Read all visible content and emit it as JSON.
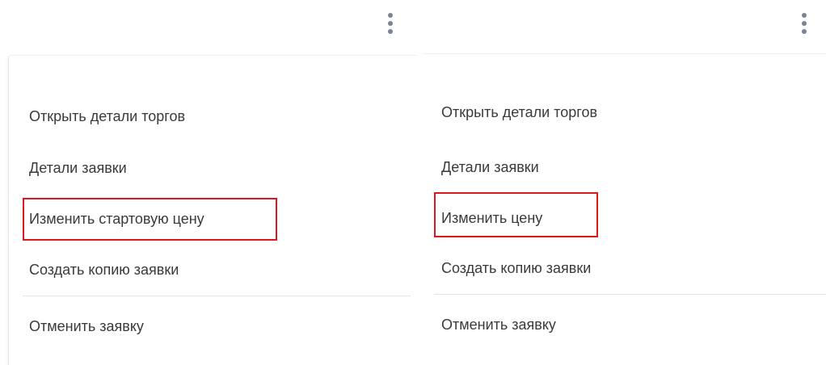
{
  "menus": [
    {
      "items": [
        {
          "label": "Открыть детали торгов"
        },
        {
          "label": "Детали заявки"
        },
        {
          "label": "Изменить стартовую цену"
        },
        {
          "label": "Создать копию заявки"
        },
        {
          "label": "Отменить заявку"
        }
      ]
    },
    {
      "items": [
        {
          "label": "Открыть детали торгов"
        },
        {
          "label": "Детали заявки"
        },
        {
          "label": "Изменить цену"
        },
        {
          "label": "Создать копию заявки"
        },
        {
          "label": "Отменить заявку"
        }
      ]
    }
  ],
  "icons": {
    "kebab": "more-vertical-icon"
  },
  "colors": {
    "highlight": "#e0161b",
    "text": "#3a3a3a",
    "icon": "#7a8591",
    "divider": "#e2e2e2"
  }
}
